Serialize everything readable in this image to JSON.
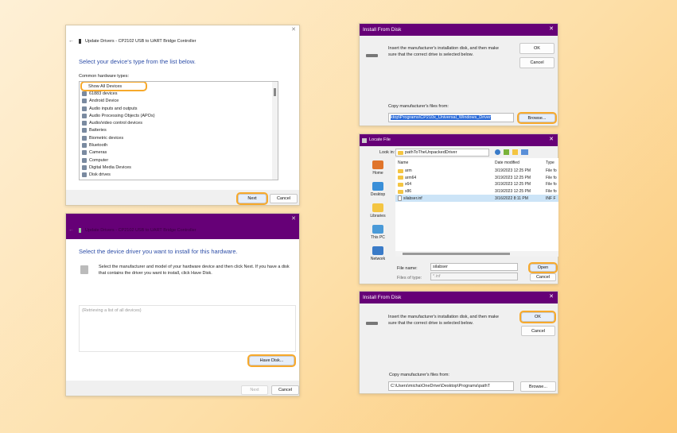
{
  "accent_color": "#660077",
  "highlight_color": "#f7a92b",
  "panel1": {
    "title": "Update Drivers - CP2102 USB to UART Bridge Controller",
    "heading": "Select your device's type from the list below.",
    "list_label": "Common hardware types:",
    "items": [
      "Show All Devices",
      "61883 devices",
      "Android Device",
      "Audio inputs and outputs",
      "Audio Processing Objects (APOs)",
      "Audio/video control devices",
      "Batteries",
      "Biometric devices",
      "Bluetooth",
      "Cameras",
      "Computer",
      "Digital Media Devices",
      "Disk drives"
    ],
    "next": "Next",
    "cancel": "Cancel"
  },
  "panel2": {
    "title": "Update Drivers - CP2102 USB to UART Bridge Controller",
    "heading": "Select the device driver you want to install for this hardware.",
    "description": "Select the manufacturer and model of your hardware device and then click Next. If you have a disk that contains the driver you want to install, click Have Disk.",
    "list_placeholder": "(Retrieving a list of all devices)",
    "have_disk": "Have Disk...",
    "next": "Next",
    "cancel": "Cancel"
  },
  "panel3": {
    "title": "Install From Disk",
    "message": "Insert the manufacturer's installation disk, and then make sure that the correct drive is selected below.",
    "ok": "OK",
    "cancel": "Cancel",
    "copy_label": "Copy manufacturer's files from:",
    "path": "ktop\\Programs\\CP210x_Universal_Windows_Driver",
    "browse": "Browse..."
  },
  "panel4": {
    "title": "Locate File",
    "look_in_label": "Look in:",
    "look_in": "pathToTheUnpackedDriver",
    "sidebar": [
      "Home",
      "Desktop",
      "Libraries",
      "This PC",
      "Network"
    ],
    "columns": [
      "Name",
      "Date modified",
      "Type"
    ],
    "files": [
      {
        "name": "arm",
        "date": "3/19/2023 12:25 PM",
        "type": "File fo",
        "folder": true
      },
      {
        "name": "arm64",
        "date": "3/19/2023 12:25 PM",
        "type": "File fo",
        "folder": true
      },
      {
        "name": "x64",
        "date": "3/19/2023 12:25 PM",
        "type": "File fo",
        "folder": true
      },
      {
        "name": "x86",
        "date": "3/19/2023 12:25 PM",
        "type": "File fo",
        "folder": true
      },
      {
        "name": "silabser.inf",
        "date": "3/16/2022 8:11 PM",
        "type": "INF F",
        "folder": false,
        "selected": true
      }
    ],
    "file_name_label": "File name:",
    "file_name": "silabser",
    "file_type_label": "Files of type:",
    "file_type": "*.inf",
    "open": "Open",
    "cancel": "Cancel"
  },
  "panel5": {
    "title": "Install From Disk",
    "message": "Insert the manufacturer's installation disk, and then make sure that the correct drive is selected below.",
    "ok": "OK",
    "cancel": "Cancel",
    "copy_label": "Copy manufacturer's files from:",
    "path": "C:\\Users\\micha\\OneDrive\\Desktop\\Programs\\pathT",
    "browse": "Browse..."
  }
}
